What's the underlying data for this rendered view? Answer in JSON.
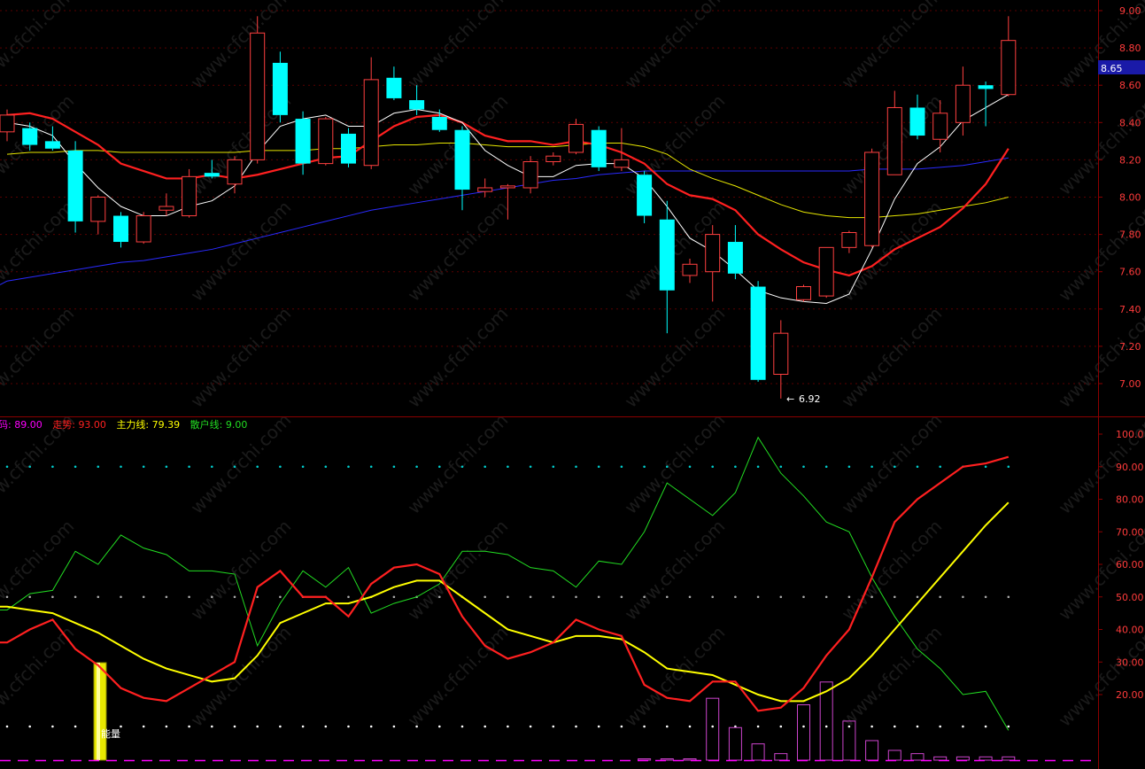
{
  "price_panel": {
    "current_price_tag": "8.65",
    "low_annotation": "6.92",
    "y_ticks": [
      "9.00",
      "8.80",
      "8.60",
      "8.40",
      "8.20",
      "8.00",
      "7.80",
      "7.60",
      "7.40",
      "7.20",
      "7.00"
    ]
  },
  "indicator_panel": {
    "legend": [
      {
        "label": "筹码:",
        "value": "89.00",
        "color": "#ff00ff"
      },
      {
        "label": "走势:",
        "value": "93.00",
        "color": "#ff2020"
      },
      {
        "label": "主力线:",
        "value": "79.39",
        "color": "#ffff00"
      },
      {
        "label": "散户线:",
        "value": "9.00",
        "color": "#22dd22"
      }
    ],
    "y_ticks": [
      "100.0",
      "90.00",
      "80.00",
      "70.00",
      "60.00",
      "50.00",
      "40.00",
      "30.00",
      "20.00"
    ],
    "volume_tag": "能量"
  },
  "watermark": "www.cfchi.com",
  "colors": {
    "up_candle": "#ff4040",
    "down_candle": "#00ffff",
    "ma_fast": "#ffffff",
    "ma_mid": "#ff2020",
    "ma_slow": "#e6e600",
    "ma_long": "#2a2aff",
    "axis": "#8b0000",
    "trend_line": "#ff2020",
    "main_line": "#ffff00",
    "retail_line": "#22dd22",
    "chip_bars": "#cc44cc"
  },
  "chart_data": [
    {
      "type": "candlestick",
      "ylim": [
        6.85,
        9.05
      ],
      "candles": [
        {
          "o": 8.35,
          "h": 8.47,
          "l": 8.3,
          "c": 8.44
        },
        {
          "o": 8.37,
          "h": 8.4,
          "l": 8.25,
          "c": 8.28
        },
        {
          "o": 8.3,
          "h": 8.38,
          "l": 8.25,
          "c": 8.26
        },
        {
          "o": 8.25,
          "h": 8.3,
          "l": 7.81,
          "c": 7.87
        },
        {
          "o": 7.87,
          "h": 8.01,
          "l": 7.8,
          "c": 8.0
        },
        {
          "o": 7.9,
          "h": 7.92,
          "l": 7.73,
          "c": 7.76
        },
        {
          "o": 7.76,
          "h": 7.92,
          "l": 7.75,
          "c": 7.9
        },
        {
          "o": 7.93,
          "h": 8.02,
          "l": 7.9,
          "c": 7.95
        },
        {
          "o": 7.9,
          "h": 8.15,
          "l": 7.89,
          "c": 8.11
        },
        {
          "o": 8.13,
          "h": 8.2,
          "l": 8.1,
          "c": 8.11
        },
        {
          "o": 8.07,
          "h": 8.22,
          "l": 8.02,
          "c": 8.2
        },
        {
          "o": 8.2,
          "h": 8.97,
          "l": 8.18,
          "c": 8.88
        },
        {
          "o": 8.72,
          "h": 8.78,
          "l": 8.4,
          "c": 8.44
        },
        {
          "o": 8.42,
          "h": 8.46,
          "l": 8.12,
          "c": 8.18
        },
        {
          "o": 8.18,
          "h": 8.43,
          "l": 8.17,
          "c": 8.42
        },
        {
          "o": 8.34,
          "h": 8.37,
          "l": 8.16,
          "c": 8.18
        },
        {
          "o": 8.17,
          "h": 8.75,
          "l": 8.15,
          "c": 8.63
        },
        {
          "o": 8.64,
          "h": 8.7,
          "l": 8.52,
          "c": 8.53
        },
        {
          "o": 8.52,
          "h": 8.6,
          "l": 8.44,
          "c": 8.47
        },
        {
          "o": 8.43,
          "h": 8.47,
          "l": 8.35,
          "c": 8.36
        },
        {
          "o": 8.36,
          "h": 8.38,
          "l": 7.93,
          "c": 8.04
        },
        {
          "o": 8.03,
          "h": 8.1,
          "l": 8.0,
          "c": 8.05
        },
        {
          "o": 8.05,
          "h": 8.07,
          "l": 7.88,
          "c": 8.06
        },
        {
          "o": 8.05,
          "h": 8.22,
          "l": 8.02,
          "c": 8.19
        },
        {
          "o": 8.19,
          "h": 8.24,
          "l": 8.17,
          "c": 8.22
        },
        {
          "o": 8.24,
          "h": 8.42,
          "l": 8.23,
          "c": 8.39
        },
        {
          "o": 8.36,
          "h": 8.38,
          "l": 8.14,
          "c": 8.16
        },
        {
          "o": 8.16,
          "h": 8.37,
          "l": 8.14,
          "c": 8.2
        },
        {
          "o": 8.12,
          "h": 8.14,
          "l": 7.86,
          "c": 7.9
        },
        {
          "o": 7.88,
          "h": 7.98,
          "l": 7.27,
          "c": 7.5
        },
        {
          "o": 7.58,
          "h": 7.67,
          "l": 7.54,
          "c": 7.64
        },
        {
          "o": 7.6,
          "h": 7.85,
          "l": 7.44,
          "c": 7.8
        },
        {
          "o": 7.76,
          "h": 7.85,
          "l": 7.56,
          "c": 7.59
        },
        {
          "o": 7.52,
          "h": 7.55,
          "l": 7.01,
          "c": 7.02
        },
        {
          "o": 7.05,
          "h": 7.34,
          "l": 6.92,
          "c": 7.27
        },
        {
          "o": 7.45,
          "h": 7.53,
          "l": 7.44,
          "c": 7.52
        },
        {
          "o": 7.47,
          "h": 7.73,
          "l": 7.46,
          "c": 7.73
        },
        {
          "o": 7.73,
          "h": 7.82,
          "l": 7.7,
          "c": 7.81
        },
        {
          "o": 7.74,
          "h": 8.26,
          "l": 7.73,
          "c": 8.24
        },
        {
          "o": 8.12,
          "h": 8.57,
          "l": 8.12,
          "c": 8.48
        },
        {
          "o": 8.48,
          "h": 8.55,
          "l": 8.31,
          "c": 8.33
        },
        {
          "o": 8.31,
          "h": 8.52,
          "l": 8.24,
          "c": 8.45
        },
        {
          "o": 8.4,
          "h": 8.7,
          "l": 8.33,
          "c": 8.6
        },
        {
          "o": 8.6,
          "h": 8.62,
          "l": 8.38,
          "c": 8.58
        },
        {
          "o": 8.55,
          "h": 8.97,
          "l": 8.54,
          "c": 8.84
        }
      ],
      "ma_fast": [
        8.4,
        8.38,
        8.33,
        8.18,
        8.05,
        7.95,
        7.9,
        7.9,
        7.95,
        7.98,
        8.06,
        8.24,
        8.38,
        8.42,
        8.44,
        8.38,
        8.38,
        8.45,
        8.47,
        8.45,
        8.4,
        8.25,
        8.17,
        8.11,
        8.11,
        8.17,
        8.18,
        8.18,
        8.1,
        7.95,
        7.78,
        7.71,
        7.61,
        7.5,
        7.46,
        7.44,
        7.43,
        7.48,
        7.72,
        7.99,
        8.18,
        8.27,
        8.41,
        8.48,
        8.55
      ],
      "ma_mid": [
        8.44,
        8.45,
        8.42,
        8.35,
        8.28,
        8.18,
        8.14,
        8.1,
        8.1,
        8.12,
        8.1,
        8.12,
        8.15,
        8.18,
        8.21,
        8.22,
        8.3,
        8.38,
        8.43,
        8.44,
        8.4,
        8.33,
        8.3,
        8.3,
        8.28,
        8.3,
        8.28,
        8.24,
        8.18,
        8.07,
        8.01,
        7.99,
        7.93,
        7.8,
        7.72,
        7.65,
        7.61,
        7.58,
        7.63,
        7.72,
        7.78,
        7.84,
        7.94,
        8.07,
        8.26
      ],
      "ma_slow": [
        8.23,
        8.24,
        8.24,
        8.25,
        8.25,
        8.24,
        8.24,
        8.24,
        8.24,
        8.24,
        8.24,
        8.25,
        8.25,
        8.25,
        8.26,
        8.26,
        8.27,
        8.28,
        8.28,
        8.29,
        8.29,
        8.28,
        8.27,
        8.27,
        8.27,
        8.28,
        8.29,
        8.29,
        8.27,
        8.23,
        8.15,
        8.1,
        8.06,
        8.01,
        7.96,
        7.92,
        7.9,
        7.89,
        7.89,
        7.9,
        7.91,
        7.93,
        7.95,
        7.97,
        8.0
      ],
      "ma_long": [
        7.55,
        7.57,
        7.59,
        7.61,
        7.63,
        7.65,
        7.66,
        7.68,
        7.7,
        7.72,
        7.75,
        7.78,
        7.81,
        7.84,
        7.87,
        7.9,
        7.93,
        7.95,
        7.97,
        7.99,
        8.01,
        8.03,
        8.05,
        8.07,
        8.09,
        8.1,
        8.12,
        8.13,
        8.14,
        8.14,
        8.14,
        8.14,
        8.14,
        8.14,
        8.14,
        8.14,
        8.14,
        8.14,
        8.15,
        8.15,
        8.15,
        8.16,
        8.17,
        8.19,
        8.21
      ]
    },
    {
      "type": "line",
      "ylim": [
        10,
        104
      ],
      "series": [
        {
          "name": "走势",
          "values": [
            36,
            40,
            43,
            34,
            29,
            22,
            19,
            18,
            22,
            26,
            30,
            53,
            58,
            50,
            50,
            44,
            54,
            59,
            60,
            57,
            44,
            35,
            31,
            33,
            36,
            43,
            40,
            38,
            23,
            19,
            18,
            24,
            24,
            15,
            16,
            22,
            32,
            40,
            56,
            73,
            80,
            85,
            90,
            91,
            93
          ]
        },
        {
          "name": "主力线",
          "values": [
            47,
            46,
            45,
            42,
            39,
            35,
            31,
            28,
            26,
            24,
            25,
            32,
            42,
            45,
            48,
            48,
            50,
            53,
            55,
            55,
            50,
            45,
            40,
            38,
            36,
            38,
            38,
            37,
            33,
            28,
            27,
            26,
            23,
            20,
            18,
            18,
            21,
            25,
            32,
            40,
            48,
            56,
            64,
            72,
            79
          ]
        },
        {
          "name": "散户线",
          "values": [
            46,
            51,
            52,
            64,
            60,
            69,
            65,
            63,
            58,
            58,
            57,
            35,
            48,
            58,
            53,
            59,
            45,
            48,
            50,
            54,
            64,
            64,
            63,
            59,
            58,
            53,
            61,
            60,
            70,
            85,
            80,
            75,
            82,
            99,
            88,
            81,
            73,
            70,
            56,
            44,
            34,
            28,
            20,
            21,
            9
          ]
        },
        {
          "name": "筹码",
          "bars_from_index": 28,
          "values": [
            0,
            0,
            0,
            19,
            10,
            5,
            2,
            17,
            24,
            12,
            6,
            3,
            2,
            1,
            1,
            1,
            1
          ]
        }
      ]
    }
  ]
}
